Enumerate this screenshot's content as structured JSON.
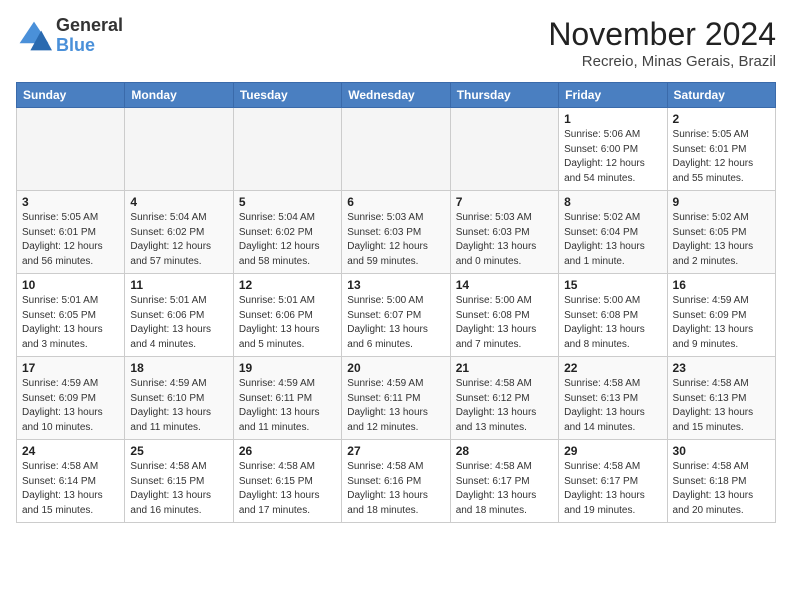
{
  "logo": {
    "line1": "General",
    "line2": "Blue"
  },
  "title": "November 2024",
  "location": "Recreio, Minas Gerais, Brazil",
  "headers": [
    "Sunday",
    "Monday",
    "Tuesday",
    "Wednesday",
    "Thursday",
    "Friday",
    "Saturday"
  ],
  "weeks": [
    [
      {
        "day": "",
        "empty": true
      },
      {
        "day": "",
        "empty": true
      },
      {
        "day": "",
        "empty": true
      },
      {
        "day": "",
        "empty": true
      },
      {
        "day": "",
        "empty": true
      },
      {
        "day": "1",
        "sunrise": "Sunrise: 5:06 AM",
        "sunset": "Sunset: 6:00 PM",
        "daylight": "Daylight: 12 hours and 54 minutes."
      },
      {
        "day": "2",
        "sunrise": "Sunrise: 5:05 AM",
        "sunset": "Sunset: 6:01 PM",
        "daylight": "Daylight: 12 hours and 55 minutes."
      }
    ],
    [
      {
        "day": "3",
        "sunrise": "Sunrise: 5:05 AM",
        "sunset": "Sunset: 6:01 PM",
        "daylight": "Daylight: 12 hours and 56 minutes."
      },
      {
        "day": "4",
        "sunrise": "Sunrise: 5:04 AM",
        "sunset": "Sunset: 6:02 PM",
        "daylight": "Daylight: 12 hours and 57 minutes."
      },
      {
        "day": "5",
        "sunrise": "Sunrise: 5:04 AM",
        "sunset": "Sunset: 6:02 PM",
        "daylight": "Daylight: 12 hours and 58 minutes."
      },
      {
        "day": "6",
        "sunrise": "Sunrise: 5:03 AM",
        "sunset": "Sunset: 6:03 PM",
        "daylight": "Daylight: 12 hours and 59 minutes."
      },
      {
        "day": "7",
        "sunrise": "Sunrise: 5:03 AM",
        "sunset": "Sunset: 6:03 PM",
        "daylight": "Daylight: 13 hours and 0 minutes."
      },
      {
        "day": "8",
        "sunrise": "Sunrise: 5:02 AM",
        "sunset": "Sunset: 6:04 PM",
        "daylight": "Daylight: 13 hours and 1 minute."
      },
      {
        "day": "9",
        "sunrise": "Sunrise: 5:02 AM",
        "sunset": "Sunset: 6:05 PM",
        "daylight": "Daylight: 13 hours and 2 minutes."
      }
    ],
    [
      {
        "day": "10",
        "sunrise": "Sunrise: 5:01 AM",
        "sunset": "Sunset: 6:05 PM",
        "daylight": "Daylight: 13 hours and 3 minutes."
      },
      {
        "day": "11",
        "sunrise": "Sunrise: 5:01 AM",
        "sunset": "Sunset: 6:06 PM",
        "daylight": "Daylight: 13 hours and 4 minutes."
      },
      {
        "day": "12",
        "sunrise": "Sunrise: 5:01 AM",
        "sunset": "Sunset: 6:06 PM",
        "daylight": "Daylight: 13 hours and 5 minutes."
      },
      {
        "day": "13",
        "sunrise": "Sunrise: 5:00 AM",
        "sunset": "Sunset: 6:07 PM",
        "daylight": "Daylight: 13 hours and 6 minutes."
      },
      {
        "day": "14",
        "sunrise": "Sunrise: 5:00 AM",
        "sunset": "Sunset: 6:08 PM",
        "daylight": "Daylight: 13 hours and 7 minutes."
      },
      {
        "day": "15",
        "sunrise": "Sunrise: 5:00 AM",
        "sunset": "Sunset: 6:08 PM",
        "daylight": "Daylight: 13 hours and 8 minutes."
      },
      {
        "day": "16",
        "sunrise": "Sunrise: 4:59 AM",
        "sunset": "Sunset: 6:09 PM",
        "daylight": "Daylight: 13 hours and 9 minutes."
      }
    ],
    [
      {
        "day": "17",
        "sunrise": "Sunrise: 4:59 AM",
        "sunset": "Sunset: 6:09 PM",
        "daylight": "Daylight: 13 hours and 10 minutes."
      },
      {
        "day": "18",
        "sunrise": "Sunrise: 4:59 AM",
        "sunset": "Sunset: 6:10 PM",
        "daylight": "Daylight: 13 hours and 11 minutes."
      },
      {
        "day": "19",
        "sunrise": "Sunrise: 4:59 AM",
        "sunset": "Sunset: 6:11 PM",
        "daylight": "Daylight: 13 hours and 11 minutes."
      },
      {
        "day": "20",
        "sunrise": "Sunrise: 4:59 AM",
        "sunset": "Sunset: 6:11 PM",
        "daylight": "Daylight: 13 hours and 12 minutes."
      },
      {
        "day": "21",
        "sunrise": "Sunrise: 4:58 AM",
        "sunset": "Sunset: 6:12 PM",
        "daylight": "Daylight: 13 hours and 13 minutes."
      },
      {
        "day": "22",
        "sunrise": "Sunrise: 4:58 AM",
        "sunset": "Sunset: 6:13 PM",
        "daylight": "Daylight: 13 hours and 14 minutes."
      },
      {
        "day": "23",
        "sunrise": "Sunrise: 4:58 AM",
        "sunset": "Sunset: 6:13 PM",
        "daylight": "Daylight: 13 hours and 15 minutes."
      }
    ],
    [
      {
        "day": "24",
        "sunrise": "Sunrise: 4:58 AM",
        "sunset": "Sunset: 6:14 PM",
        "daylight": "Daylight: 13 hours and 15 minutes."
      },
      {
        "day": "25",
        "sunrise": "Sunrise: 4:58 AM",
        "sunset": "Sunset: 6:15 PM",
        "daylight": "Daylight: 13 hours and 16 minutes."
      },
      {
        "day": "26",
        "sunrise": "Sunrise: 4:58 AM",
        "sunset": "Sunset: 6:15 PM",
        "daylight": "Daylight: 13 hours and 17 minutes."
      },
      {
        "day": "27",
        "sunrise": "Sunrise: 4:58 AM",
        "sunset": "Sunset: 6:16 PM",
        "daylight": "Daylight: 13 hours and 18 minutes."
      },
      {
        "day": "28",
        "sunrise": "Sunrise: 4:58 AM",
        "sunset": "Sunset: 6:17 PM",
        "daylight": "Daylight: 13 hours and 18 minutes."
      },
      {
        "day": "29",
        "sunrise": "Sunrise: 4:58 AM",
        "sunset": "Sunset: 6:17 PM",
        "daylight": "Daylight: 13 hours and 19 minutes."
      },
      {
        "day": "30",
        "sunrise": "Sunrise: 4:58 AM",
        "sunset": "Sunset: 6:18 PM",
        "daylight": "Daylight: 13 hours and 20 minutes."
      }
    ]
  ]
}
